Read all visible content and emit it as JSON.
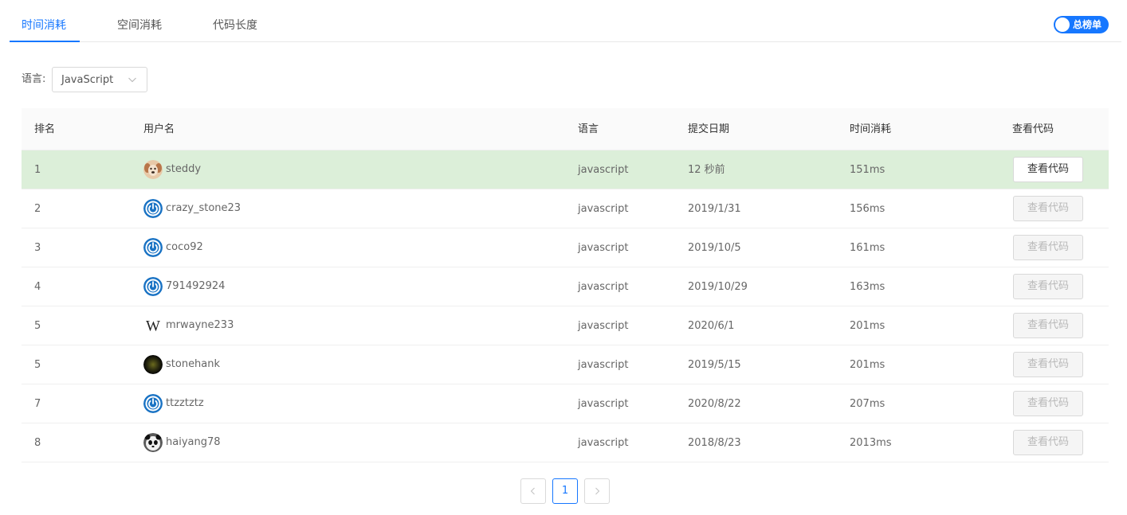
{
  "tabs": [
    {
      "label": "时间消耗",
      "active": true
    },
    {
      "label": "空间消耗",
      "active": false
    },
    {
      "label": "代码长度",
      "active": false
    }
  ],
  "toggle": {
    "label": "总榜单",
    "on": true
  },
  "filter": {
    "label": "语言:",
    "value": "JavaScript"
  },
  "table": {
    "headers": [
      "排名",
      "用户名",
      "语言",
      "提交日期",
      "时间消耗",
      "查看代码"
    ],
    "rows": [
      {
        "rank": "1",
        "user": "steddy",
        "avatar": "dog-avatar",
        "lang": "javascript",
        "date": "12 秒前",
        "time": "151ms",
        "action": "查看代码",
        "highlighted": true,
        "enabled": true
      },
      {
        "rank": "2",
        "user": "crazy_stone23",
        "avatar": "power-avatar",
        "lang": "javascript",
        "date": "2019/1/31",
        "time": "156ms",
        "action": "查看代码",
        "highlighted": false,
        "enabled": false
      },
      {
        "rank": "3",
        "user": "coco92",
        "avatar": "power-avatar",
        "lang": "javascript",
        "date": "2019/10/5",
        "time": "161ms",
        "action": "查看代码",
        "highlighted": false,
        "enabled": false
      },
      {
        "rank": "4",
        "user": "791492924",
        "avatar": "power-avatar",
        "lang": "javascript",
        "date": "2019/10/29",
        "time": "163ms",
        "action": "查看代码",
        "highlighted": false,
        "enabled": false
      },
      {
        "rank": "5",
        "user": "mrwayne233",
        "avatar": "w-avatar",
        "lang": "javascript",
        "date": "2020/6/1",
        "time": "201ms",
        "action": "查看代码",
        "highlighted": false,
        "enabled": false
      },
      {
        "rank": "5",
        "user": "stonehank",
        "avatar": "dark-avatar",
        "lang": "javascript",
        "date": "2019/5/15",
        "time": "201ms",
        "action": "查看代码",
        "highlighted": false,
        "enabled": false
      },
      {
        "rank": "7",
        "user": "ttzztztz",
        "avatar": "power-avatar",
        "lang": "javascript",
        "date": "2020/8/22",
        "time": "207ms",
        "action": "查看代码",
        "highlighted": false,
        "enabled": false
      },
      {
        "rank": "8",
        "user": "haiyang78",
        "avatar": "panda-avatar",
        "lang": "javascript",
        "date": "2018/8/23",
        "time": "2013ms",
        "action": "查看代码",
        "highlighted": false,
        "enabled": false
      }
    ]
  },
  "pagination": {
    "current": "1"
  },
  "colors": {
    "accent": "#1677ff",
    "highlight_row": "#dcefd9",
    "power_icon": "#1a73c4"
  },
  "icons": {
    "prev": "chevron-left-icon",
    "next": "chevron-right-icon",
    "select": "chevron-down-icon"
  }
}
